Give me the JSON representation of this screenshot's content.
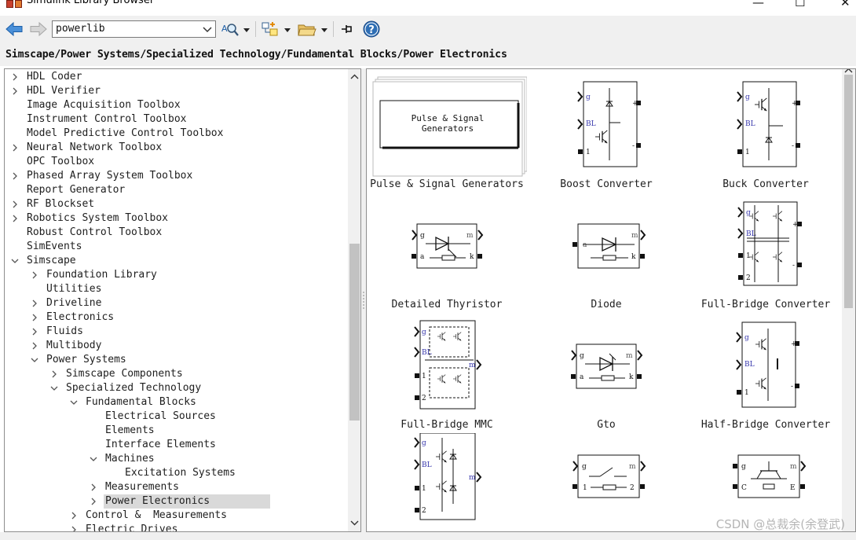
{
  "window": {
    "title": "Simulink Library Browser"
  },
  "toolbar": {
    "back_icon": "arrow-left-icon",
    "forward_icon": "arrow-right-icon",
    "library_value": "powerlib",
    "find_icon": "find-block-icon",
    "new_model_icon": "new-model-icon",
    "open_icon": "open-folder-icon",
    "pin_icon": "pin-icon",
    "help_icon": "help-icon",
    "help_glyph": "?"
  },
  "path": {
    "text": "Simscape/Power Systems/Specialized Technology/Fundamental Blocks/Power Electronics"
  },
  "tree": {
    "items": [
      {
        "label": "HDL Coder",
        "level": 0,
        "chevron": "right"
      },
      {
        "label": "HDL Verifier",
        "level": 0,
        "chevron": "right"
      },
      {
        "label": "Image Acquisition Toolbox",
        "level": 0,
        "chevron": "none"
      },
      {
        "label": "Instrument Control Toolbox",
        "level": 0,
        "chevron": "none"
      },
      {
        "label": "Model Predictive Control Toolbox",
        "level": 0,
        "chevron": "none"
      },
      {
        "label": "Neural Network Toolbox",
        "level": 0,
        "chevron": "right"
      },
      {
        "label": "OPC Toolbox",
        "level": 0,
        "chevron": "none"
      },
      {
        "label": "Phased Array System Toolbox",
        "level": 0,
        "chevron": "right"
      },
      {
        "label": "Report Generator",
        "level": 0,
        "chevron": "none"
      },
      {
        "label": "RF Blockset",
        "level": 0,
        "chevron": "right"
      },
      {
        "label": "Robotics System Toolbox",
        "level": 0,
        "chevron": "right"
      },
      {
        "label": "Robust Control Toolbox",
        "level": 0,
        "chevron": "none"
      },
      {
        "label": "SimEvents",
        "level": 0,
        "chevron": "none"
      },
      {
        "label": "Simscape",
        "level": 0,
        "chevron": "down"
      },
      {
        "label": "Foundation Library",
        "level": 1,
        "chevron": "right"
      },
      {
        "label": "Utilities",
        "level": 1,
        "chevron": "none"
      },
      {
        "label": "Driveline",
        "level": 1,
        "chevron": "right"
      },
      {
        "label": "Electronics",
        "level": 1,
        "chevron": "right"
      },
      {
        "label": "Fluids",
        "level": 1,
        "chevron": "right"
      },
      {
        "label": "Multibody",
        "level": 1,
        "chevron": "right"
      },
      {
        "label": "Power Systems",
        "level": 1,
        "chevron": "down"
      },
      {
        "label": "Simscape Components",
        "level": 2,
        "chevron": "right"
      },
      {
        "label": "Specialized Technology",
        "level": 2,
        "chevron": "down"
      },
      {
        "label": "Fundamental Blocks",
        "level": 3,
        "chevron": "down"
      },
      {
        "label": "Electrical Sources",
        "level": 4,
        "chevron": "none"
      },
      {
        "label": "Elements",
        "level": 4,
        "chevron": "none"
      },
      {
        "label": "Interface Elements",
        "level": 4,
        "chevron": "none"
      },
      {
        "label": "Machines",
        "level": 4,
        "chevron": "down"
      },
      {
        "label": "Excitation Systems",
        "level": 5,
        "chevron": "none"
      },
      {
        "label": "Measurements",
        "level": 4,
        "chevron": "right"
      },
      {
        "label": "Power Electronics",
        "level": 4,
        "chevron": "right",
        "selected": true
      },
      {
        "label": "Control &  Measurements",
        "level": 3,
        "chevron": "right"
      },
      {
        "label": "Electric Drives",
        "level": 3,
        "chevron": "right"
      }
    ]
  },
  "blocks": [
    {
      "label": "Pulse & Signal Generators",
      "kind": "subsystem",
      "inner": "Pulse & Signal\nGenerators"
    },
    {
      "label": "Boost Converter",
      "kind": "boost",
      "ports": [
        "g",
        "BL",
        "1",
        "+",
        "-"
      ]
    },
    {
      "label": "Buck Converter",
      "kind": "buck",
      "ports": [
        "g",
        "BL",
        "1",
        "+",
        "-"
      ]
    },
    {
      "label": "Detailed Thyristor",
      "kind": "thyristor",
      "ports": [
        "g",
        "m",
        "a",
        "k"
      ]
    },
    {
      "label": "Diode",
      "kind": "diode",
      "ports": [
        "m",
        "a",
        "k"
      ]
    },
    {
      "label": "Full-Bridge Converter",
      "kind": "fullbridge",
      "ports": [
        "g",
        "BL",
        "1",
        "2",
        "+",
        "-"
      ]
    },
    {
      "label": "Full-Bridge MMC",
      "kind": "mmc",
      "ports": [
        "g",
        "BL",
        "1",
        "2",
        "m"
      ]
    },
    {
      "label": "Gto",
      "kind": "gto",
      "ports": [
        "g",
        "m",
        "a",
        "k"
      ]
    },
    {
      "label": "Half-Bridge Converter",
      "kind": "halfbridge",
      "ports": [
        "g",
        "BL",
        "1",
        "+",
        "-"
      ]
    },
    {
      "label": "",
      "kind": "halfbridge-mmc",
      "ports": [
        "g",
        "BL",
        "1",
        "2",
        "m"
      ]
    },
    {
      "label": "",
      "kind": "breaker",
      "ports": [
        "g",
        "m",
        "1",
        "2"
      ]
    },
    {
      "label": "",
      "kind": "igbt",
      "ports": [
        "g",
        "m",
        "C",
        "E"
      ]
    }
  ],
  "watermark": "CSDN @总裁余(余登武)"
}
